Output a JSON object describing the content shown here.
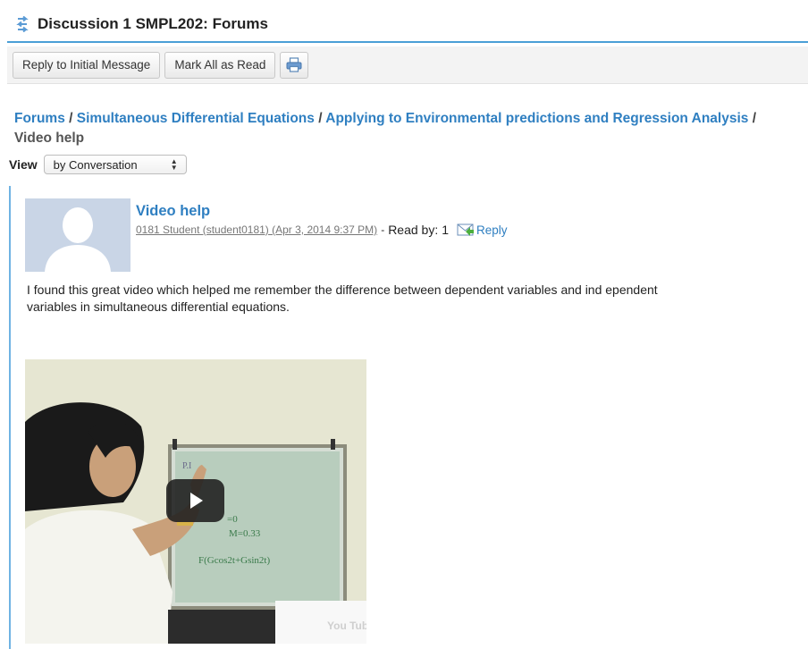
{
  "header": {
    "title": "Discussion 1 SMPL202: Forums",
    "icon": "forum-arrows-icon"
  },
  "toolbar": {
    "reply_initial_label": "Reply to Initial Message",
    "mark_read_label": "Mark All as Read",
    "print_icon": "printer-icon"
  },
  "breadcrumb": {
    "items": [
      "Forums",
      "Simultaneous Differential Equations",
      "Applying to Environmental predictions and Regression Analysis"
    ],
    "separator": "/",
    "current": "Video help"
  },
  "view": {
    "label": "View",
    "selected": "by Conversation"
  },
  "message": {
    "title": "Video help",
    "author_info": "0181 Student (student0181) (Apr 3, 2014 9:37 PM)",
    "meta_separator": "-",
    "read_by_label": "Read by:",
    "read_by_count": "1",
    "reply_label": "Reply",
    "body": "I found this great video which helped me remember the difference between dependent variables and ind ependent variables in simultaneous differential equations."
  },
  "video": {
    "board_lines": [
      "P.I",
      "=0",
      "M=0.33",
      "F(Gcos2t+Gsin2t)"
    ],
    "watermark": "You Tube"
  },
  "colors": {
    "link": "#2f7fc1",
    "accent_line": "#4a9fd6",
    "thread_line": "#6fb3e3"
  }
}
